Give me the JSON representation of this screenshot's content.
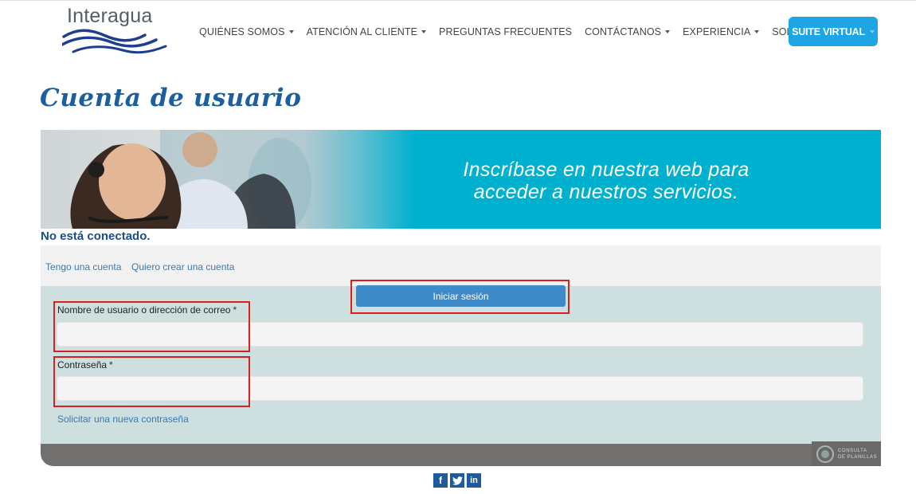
{
  "brand": {
    "name": "Interagua"
  },
  "nav": {
    "items": [
      {
        "label": "QUIÉNES SOMOS",
        "dropdown": true
      },
      {
        "label": "ATENCIÓN AL CLIENTE",
        "dropdown": true
      },
      {
        "label": "PREGUNTAS FRECUENTES",
        "dropdown": false
      },
      {
        "label": "CONTÁCTANOS",
        "dropdown": true
      },
      {
        "label": "EXPERIENCIA",
        "dropdown": true
      },
      {
        "label": "SOLICITUDES",
        "dropdown": false
      }
    ],
    "suite_button": "SUITE VIRTUAL"
  },
  "page": {
    "title": "Cuenta de usuario"
  },
  "banner": {
    "line1": "Inscríbase en nuestra web para",
    "line2": "acceder a nuestros servicios."
  },
  "status": {
    "text": "No está conectado."
  },
  "tabs": [
    {
      "label": "Tengo una cuenta"
    },
    {
      "label": "Quiero crear una cuenta"
    }
  ],
  "form": {
    "submit_label": "Iniciar sesión",
    "username": {
      "label": "Nombre de usuario o dirección de correo",
      "required_mark": "*",
      "value": ""
    },
    "password": {
      "label": "Contraseña",
      "required_mark": "*",
      "value": ""
    },
    "forgot_link": "Solicitar una nueva contraseña"
  },
  "footer": {
    "badge_line1": "CONSULTA",
    "badge_line2": "DE PLANILLAS",
    "social": [
      "f",
      "t",
      "in"
    ]
  },
  "colors": {
    "accent": "#1ea5e3",
    "title": "#1b5f9e",
    "banner": "#00b1cf",
    "panel": "#cde0df",
    "button": "#3f8ac9",
    "highlight": "#d82020"
  }
}
